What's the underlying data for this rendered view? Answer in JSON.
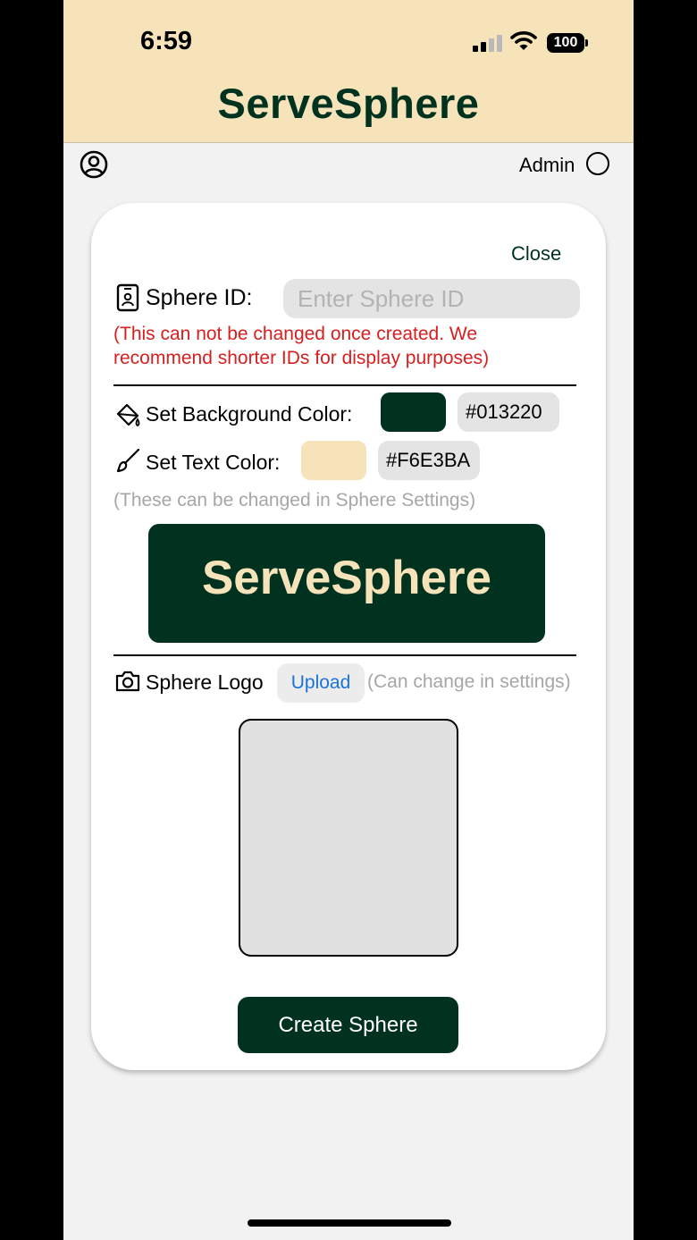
{
  "status_bar": {
    "time": "6:59",
    "battery": "100"
  },
  "header": {
    "app_title": "ServeSphere"
  },
  "user_bar": {
    "role_label": "Admin"
  },
  "modal": {
    "close_label": "Close",
    "sphere_id": {
      "label": "Sphere ID:",
      "placeholder": "Enter Sphere ID",
      "value": "",
      "warning_line1": "(This can not be changed once created. We",
      "warning_line2": "recommend shorter IDs for display purposes)"
    },
    "background_color": {
      "label": "Set Background Color:",
      "hex": "#013220"
    },
    "text_color": {
      "label": "Set Text Color:",
      "hex": "#F6E3BA"
    },
    "colors_hint": "(These can be changed in Sphere Settings)",
    "preview": {
      "title": "ServeSphere"
    },
    "logo": {
      "label": "Sphere Logo",
      "upload_label": "Upload",
      "hint": "(Can change in settings)"
    },
    "create_label": "Create Sphere"
  },
  "icons": {
    "profile": "user-circle-icon",
    "sphere_id": "id-badge-icon",
    "background": "paint-bucket-icon",
    "text": "brush-icon",
    "logo": "camera-icon"
  },
  "colors": {
    "brand_dark": "#013220",
    "brand_light": "#F6E3BA",
    "warning": "#D61F1F",
    "link": "#1A73D9"
  }
}
